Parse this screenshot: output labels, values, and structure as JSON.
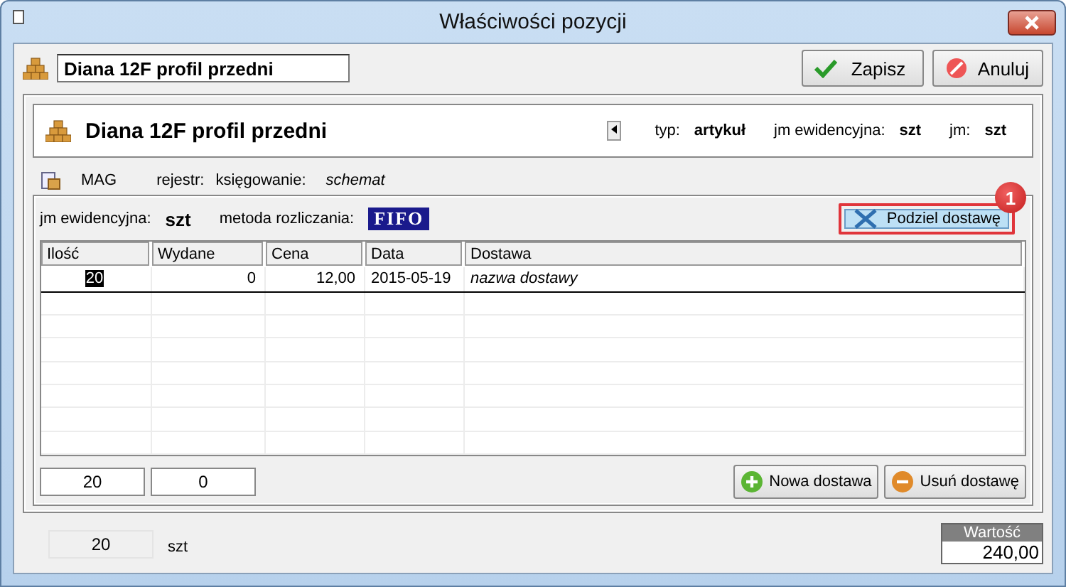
{
  "window": {
    "title": "Właściwości pozycji"
  },
  "name_field": {
    "value": "Diana 12F profil przedni"
  },
  "buttons": [
    {
      "kind": "save",
      "label": "Zapisz"
    },
    {
      "kind": "cancel",
      "label": "Anuluj"
    }
  ],
  "header": {
    "name": "Diana 12F profil przedni",
    "fields": [
      {
        "label": "typ:",
        "value": "artykuł"
      },
      {
        "label": "jm ewidencyjna:",
        "value": "szt"
      },
      {
        "label": "jm:",
        "value": "szt"
      }
    ]
  },
  "register_row": {
    "warehouse": "MAG",
    "register_label": "rejestr:",
    "posting_label": "księgowanie:",
    "posting_value": "schemat"
  },
  "deliveries": {
    "unit_label": "jm ewidencyjna:",
    "unit": "szt",
    "method_label": "metoda rozliczania:",
    "method": "FIFO",
    "split_button": {
      "label": "Podziel dostawę",
      "highlighted": true,
      "badge": "1"
    },
    "columns": [
      "Ilość",
      "Wydane",
      "Cena",
      "Data",
      "Dostawa"
    ],
    "rows": [
      {
        "cells": [
          {
            "text": "20",
            "focused": true
          },
          {
            "text": "0",
            "focused": false
          },
          {
            "text": "12,00",
            "focused": false
          },
          {
            "text": "2015-05-19",
            "focused": false
          },
          {
            "text": "nazwa dostawy",
            "focused": false
          }
        ]
      }
    ],
    "totals": [
      "20",
      "0"
    ],
    "actions": [
      {
        "kind": "add",
        "label": "Nowa dostawa"
      },
      {
        "kind": "remove",
        "label": "Usuń dostawę"
      }
    ]
  },
  "footer": {
    "quantity": "20",
    "unit": "szt",
    "value_label": "Wartość",
    "value": "240,00"
  }
}
